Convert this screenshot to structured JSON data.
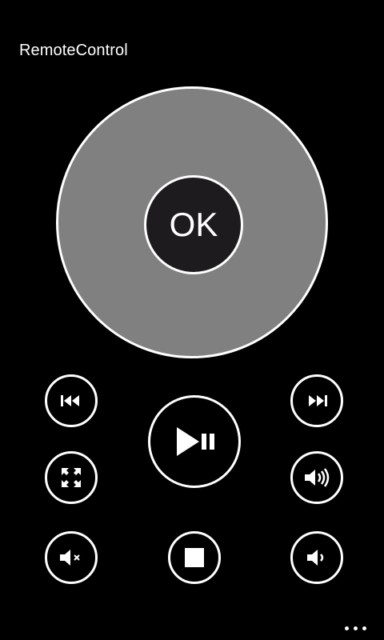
{
  "app": {
    "title": "RemoteControl"
  },
  "dpad": {
    "ok_label": "OK"
  },
  "controls": {
    "previous": "previous-track-icon",
    "next": "next-track-icon",
    "play_pause": "play-pause-icon",
    "fullscreen": "fullscreen-icon",
    "volume_up": "volume-up-icon",
    "mute": "mute-icon",
    "stop": "stop-icon",
    "volume_down": "volume-down-icon"
  },
  "appbar": {
    "more_icon": "more-dots-icon"
  },
  "colors": {
    "background": "#000000",
    "dpad": "#808080",
    "ok_fill": "#1e1b1e",
    "foreground": "#ffffff"
  }
}
